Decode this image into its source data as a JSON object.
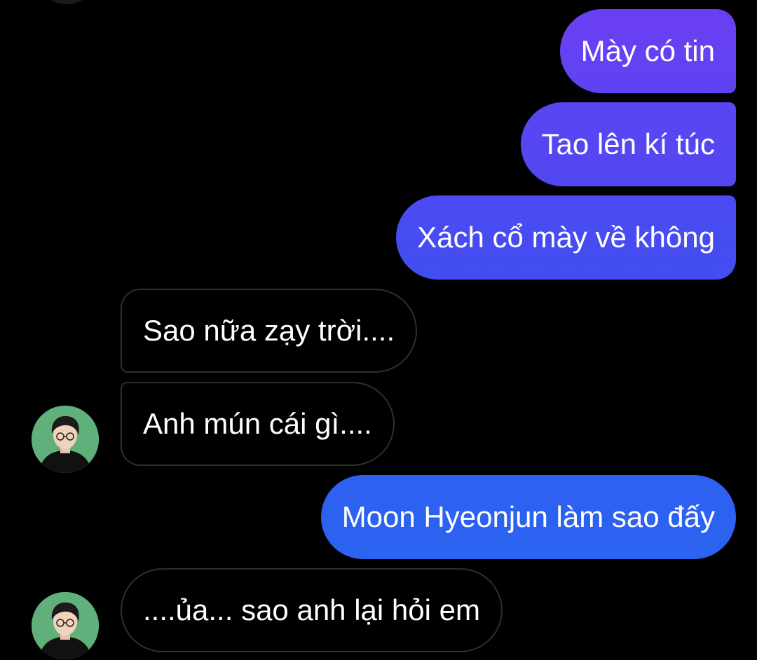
{
  "colors": {
    "background": "#000000",
    "outgoing_gradient_top": "#6a3ff1",
    "outgoing_gradient_bottom": "#1f6bf0",
    "incoming_bubble": "#000000",
    "incoming_border": "#2f2f2f",
    "avatar_background": "#5fb07a"
  },
  "messages": [
    {
      "direction": "outgoing",
      "text": "Mày có tin"
    },
    {
      "direction": "outgoing",
      "text": "Tao lên kí túc"
    },
    {
      "direction": "outgoing",
      "text": "Xách cổ mày về không"
    },
    {
      "direction": "incoming",
      "text": "Sao nữa zạy trời...."
    },
    {
      "direction": "incoming",
      "text": "Anh mún cái gì....",
      "avatar": "contact-avatar"
    },
    {
      "direction": "outgoing",
      "text": "Moon Hyeonjun làm sao đấy"
    },
    {
      "direction": "incoming",
      "text": "....ủa... sao anh lại hỏi em",
      "avatar": "contact-avatar"
    }
  ]
}
